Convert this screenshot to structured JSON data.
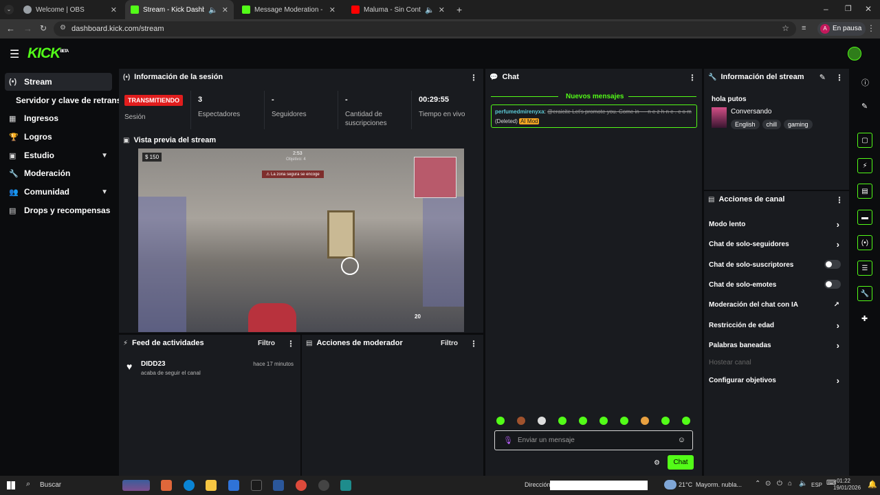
{
  "browser": {
    "tabs": [
      {
        "title": "Welcome | OBS",
        "favicon_color": "#9aa0a6"
      },
      {
        "title": "Stream - Kick Dashboard",
        "favicon_color": "#53fc18",
        "active": true
      },
      {
        "title": "Message Moderation - Kick Da",
        "favicon_color": "#53fc18"
      },
      {
        "title": "Maluma - Sin Contrato (Co",
        "favicon_color": "#ff0000"
      }
    ],
    "url": "dashboard.kick.com/stream",
    "profile_label": "En pausa",
    "profile_initial": "A"
  },
  "app": {
    "logo": "KICK",
    "logo_badge": "BETA",
    "accent": "#53fc18"
  },
  "sidebar": {
    "items": [
      {
        "label": "Stream",
        "icon": "broadcast-icon"
      },
      {
        "label": "Servidor y clave de retransm",
        "icon": ""
      },
      {
        "label": "Ingresos",
        "icon": "chart-icon"
      },
      {
        "label": "Logros",
        "icon": "trophy-icon"
      },
      {
        "label": "Estudio",
        "icon": "palette-icon"
      },
      {
        "label": "Moderación",
        "icon": "wrench-icon"
      },
      {
        "label": "Comunidad",
        "icon": "people-icon"
      },
      {
        "label": "Drops y recompensas",
        "icon": "gift-icon"
      }
    ]
  },
  "session": {
    "title": "Información de la sesión",
    "badge": "TRANSMITIENDO",
    "session_label": "Sesión",
    "stats": [
      {
        "value": "3",
        "label": "Espectadores"
      },
      {
        "value": "-",
        "label": "Seguidores"
      },
      {
        "value": "-",
        "label": "Cantidad de suscripciones"
      },
      {
        "value": "00:29:55",
        "label": "Tiempo en vivo"
      }
    ]
  },
  "preview": {
    "title": "Vista previa del stream",
    "hud": {
      "money": "150",
      "timer": "2:53",
      "objective": "Objetivo: 4",
      "alert": "La zona segura se encoge",
      "ammo": "20"
    }
  },
  "activity": {
    "title": "Feed de actividades",
    "filter": "Filtro",
    "items": [
      {
        "user": "DIDD23",
        "text": "acaba de seguir el canal",
        "time": "hace 17 minutos"
      }
    ]
  },
  "mod_actions": {
    "title": "Acciones de moderador",
    "filter": "Filtro"
  },
  "chat": {
    "title": "Chat",
    "new_messages": "Nuevos mensajes",
    "message": {
      "user": "perfumedmirenyxa",
      "text": "@eraicite Let's promote you. Come in — n e z h n e . c o m",
      "deleted": "(Deleted)",
      "badge": "AI Mod"
    },
    "input_placeholder": "Enviar un mensaje",
    "send_label": "Chat"
  },
  "stream_info": {
    "title": "Información del stream",
    "stream_title": "hola putos",
    "category": "Conversando",
    "tags": [
      "English",
      "chill",
      "gaming"
    ]
  },
  "channel_actions": {
    "title": "Acciones de canal",
    "items": [
      {
        "label": "Modo lento",
        "control": "arrow"
      },
      {
        "label": "Chat de solo-seguidores",
        "control": "arrow"
      },
      {
        "label": "Chat de solo-suscriptores",
        "control": "toggle",
        "on": false
      },
      {
        "label": "Chat de solo-emotes",
        "control": "toggle",
        "on": false
      },
      {
        "label": "Moderación del chat con IA",
        "control": "external"
      },
      {
        "label": "Restricción de edad",
        "control": "arrow"
      },
      {
        "label": "Palabras baneadas",
        "control": "arrow"
      },
      {
        "label": "Hostear canal",
        "control": "none",
        "disabled": true
      },
      {
        "label": "Configurar objetivos",
        "control": "arrow"
      }
    ]
  },
  "taskbar": {
    "search": "Buscar",
    "address_label": "Dirección",
    "weather": "21°C",
    "weather_text": "Mayorm. nubla...",
    "lang": "ESP",
    "time": "01:22",
    "date": "19/01/2026"
  }
}
